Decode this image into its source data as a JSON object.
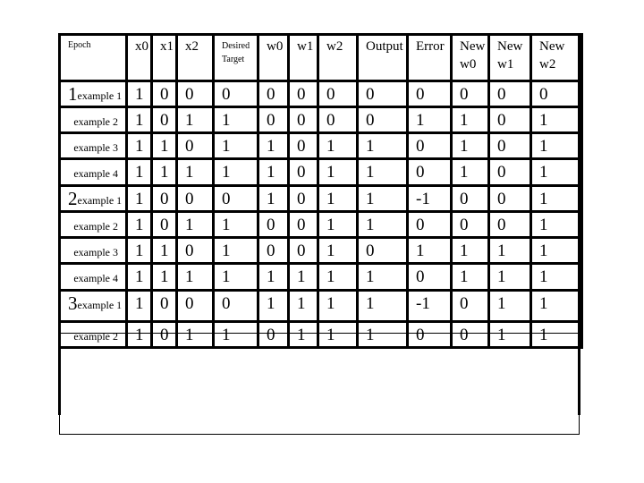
{
  "table": {
    "headers": [
      {
        "label": "Epoch"
      },
      {
        "label": "x0"
      },
      {
        "label": "x1"
      },
      {
        "label": "x2"
      },
      {
        "label": "Desired Target"
      },
      {
        "label": "w0"
      },
      {
        "label": "w1"
      },
      {
        "label": "w2"
      },
      {
        "label": "Output"
      },
      {
        "label": "Error"
      },
      {
        "label": "New w0"
      },
      {
        "label": "New w1"
      },
      {
        "label": "New w2"
      }
    ],
    "rows": [
      {
        "epoch": "1",
        "example": "example 1",
        "values": [
          "1",
          "0",
          "0",
          "0",
          "0",
          "0",
          "0",
          "0",
          "0",
          "0",
          "0",
          "0"
        ]
      },
      {
        "epoch": "",
        "example": "example 2",
        "values": [
          "1",
          "0",
          "1",
          "1",
          "0",
          "0",
          "0",
          "0",
          "1",
          "1",
          "0",
          "1"
        ]
      },
      {
        "epoch": "",
        "example": "example 3",
        "values": [
          "1",
          "1",
          "0",
          "1",
          "1",
          "0",
          "1",
          "1",
          "0",
          "1",
          "0",
          "1"
        ]
      },
      {
        "epoch": "",
        "example": "example 4",
        "values": [
          "1",
          "1",
          "1",
          "1",
          "1",
          "0",
          "1",
          "1",
          "0",
          "1",
          "0",
          "1"
        ]
      },
      {
        "epoch": "2",
        "example": "example 1",
        "values": [
          "1",
          "0",
          "0",
          "0",
          "1",
          "0",
          "1",
          "1",
          "-1",
          "0",
          "0",
          "1"
        ]
      },
      {
        "epoch": "",
        "example": "example 2",
        "values": [
          "1",
          "0",
          "1",
          "1",
          "0",
          "0",
          "1",
          "1",
          "0",
          "0",
          "0",
          "1"
        ]
      },
      {
        "epoch": "",
        "example": "example 3",
        "values": [
          "1",
          "1",
          "0",
          "1",
          "0",
          "0",
          "1",
          "0",
          "1",
          "1",
          "1",
          "1"
        ]
      },
      {
        "epoch": "",
        "example": "example 4",
        "values": [
          "1",
          "1",
          "1",
          "1",
          "1",
          "1",
          "1",
          "1",
          "0",
          "1",
          "1",
          "1"
        ]
      },
      {
        "epoch": "3",
        "example": "example 1",
        "values": [
          "1",
          "0",
          "0",
          "0",
          "1",
          "1",
          "1",
          "1",
          "-1",
          "0",
          "1",
          "1"
        ]
      },
      {
        "epoch": "",
        "example": "example 2",
        "values": [
          "1",
          "0",
          "1",
          "1",
          "0",
          "1",
          "1",
          "1",
          "0",
          "0",
          "1",
          "1"
        ]
      }
    ]
  }
}
